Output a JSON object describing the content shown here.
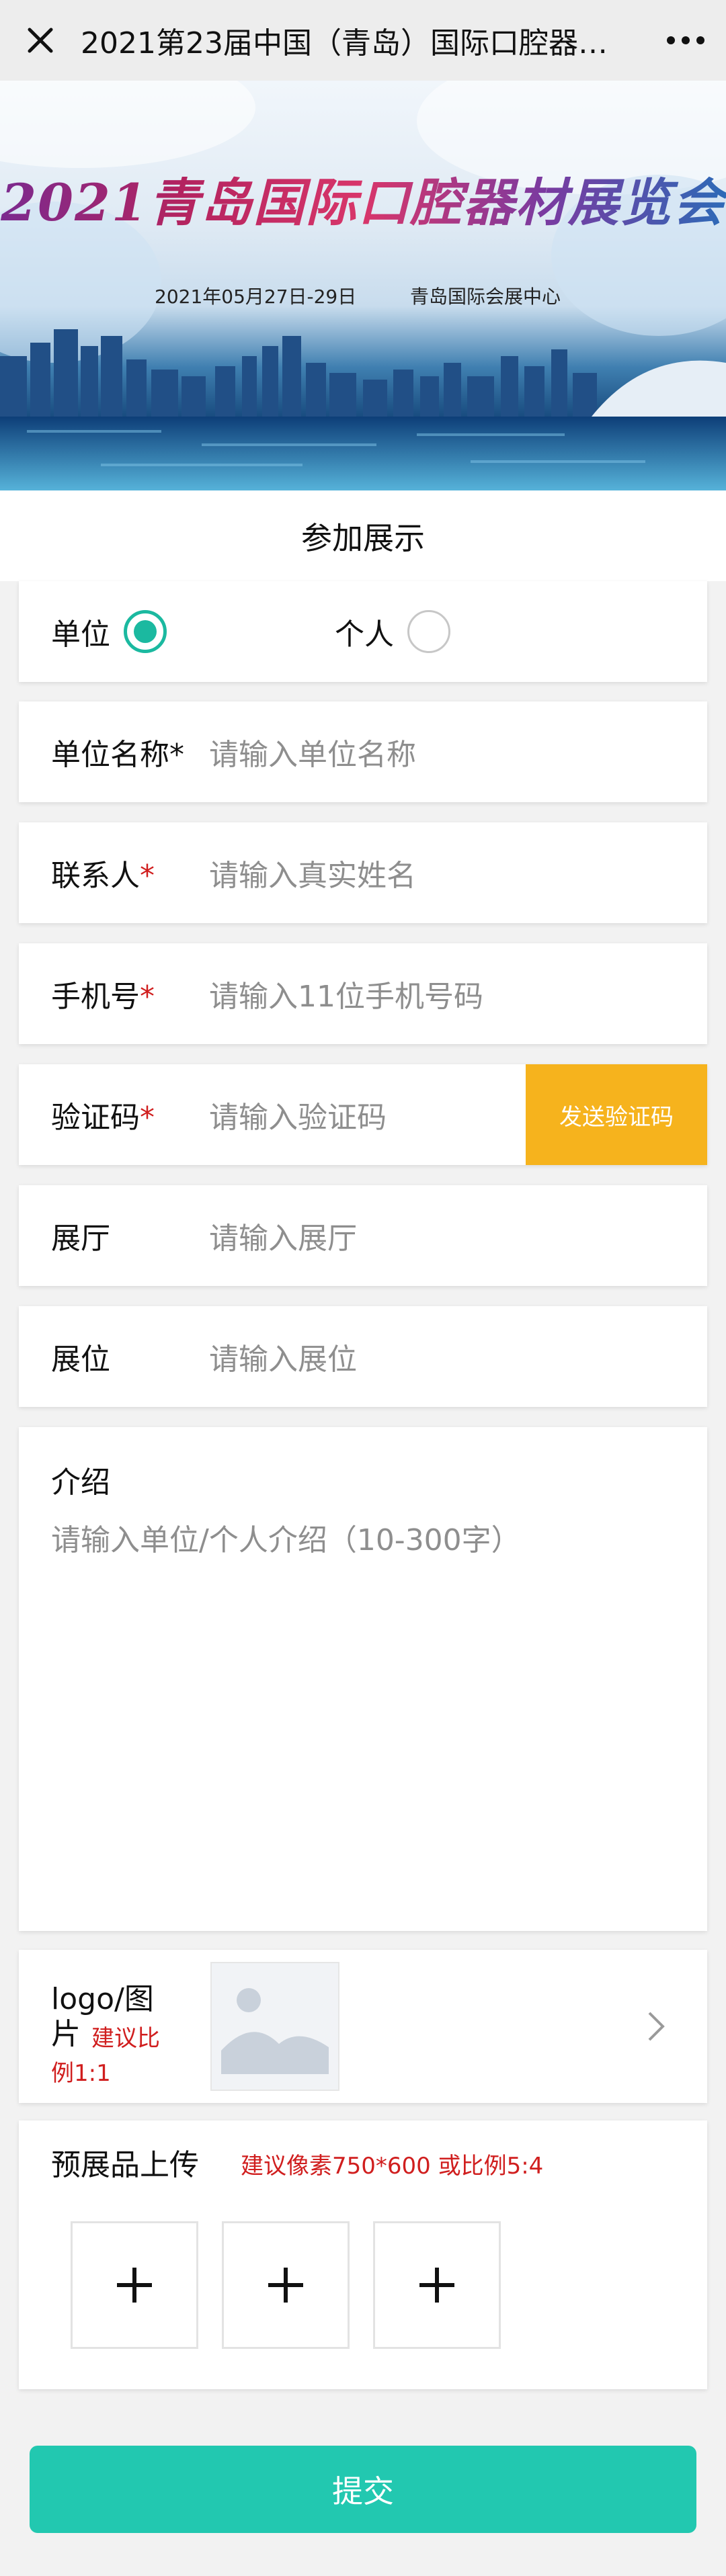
{
  "header": {
    "title": "2021第23届中国（青岛）国际口腔器材..."
  },
  "banner": {
    "title": "2021青岛国际口腔器材展览会",
    "date": "2021年05月27日-29日",
    "venue": "青岛国际会展中心"
  },
  "form": {
    "section_title": "参加展示",
    "type": {
      "options": [
        "单位",
        "个人"
      ],
      "selected": "单位"
    },
    "org_name": {
      "label": "单位名称*",
      "placeholder": "请输入单位名称"
    },
    "contact": {
      "label": "联系人",
      "required_mark": "*",
      "placeholder": "请输入真实姓名"
    },
    "phone": {
      "label": "手机号",
      "required_mark": "*",
      "placeholder": "请输入11位手机号码"
    },
    "code": {
      "label": "验证码",
      "required_mark": "*",
      "placeholder": "请输入验证码",
      "send_button": "发送验证码"
    },
    "hall": {
      "label": "展厅",
      "placeholder": "请输入展厅"
    },
    "booth": {
      "label": "展位",
      "placeholder": "请输入展位"
    },
    "intro": {
      "label": "介绍",
      "placeholder": "请输入单位/个人介绍（10-300字）"
    },
    "logo": {
      "label": "logo/图片",
      "hint": "建议比例1:1"
    },
    "products": {
      "label": "预展品上传",
      "hint": "建议像素750*600 或比例5:4"
    },
    "submit_label": "提交"
  },
  "colors": {
    "accent": "#1bb9a0",
    "submit": "#22c8b0",
    "sms_button": "#f6b31d",
    "required": "#d01e1e"
  }
}
